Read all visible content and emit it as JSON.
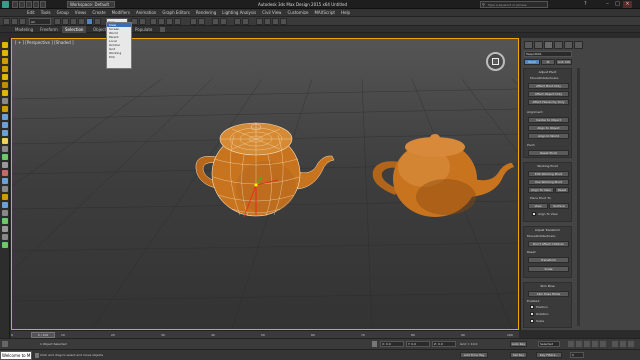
{
  "title_bar": {
    "workspace_label": "Workspace: Default",
    "app_title": "Autodesk 3ds Max Design 2015 x64    Untitled",
    "search_placeholder": "Type a keyword or phrase"
  },
  "menu": [
    "Edit",
    "Tools",
    "Group",
    "Views",
    "Create",
    "Modifiers",
    "Animation",
    "Graph Editors",
    "Rendering",
    "Lighting Analysis",
    "Civil View",
    "Customize",
    "MAXScript",
    "Help"
  ],
  "toolbar": {
    "selection_filter": "All",
    "reference_coord": "View"
  },
  "ribbon_tabs": [
    "Modeling",
    "Freeform",
    "Selection",
    "Object Paint",
    "Populate"
  ],
  "coord_dropdown": {
    "options": [
      "View",
      "Screen",
      "World",
      "Parent",
      "Local",
      "Gimbal",
      "Grid",
      "Working",
      "Pick"
    ],
    "selected": "View"
  },
  "viewport": {
    "label": "[ + ] [Perspective ] [Shaded ]"
  },
  "command_panel": {
    "object_name": "Teapot001",
    "tabs": [
      "Pivot",
      "IK",
      "Link Info"
    ],
    "adjust_pivot": {
      "title": "Adjust Pivot",
      "subtitle": "Move/Rotate/Scale:",
      "buttons": [
        "Affect Pivot Only",
        "Affect Object Only",
        "Affect Hierarchy Only"
      ]
    },
    "alignment": {
      "title": "Alignment:",
      "buttons": [
        "Center to Object",
        "Align to Object",
        "Align to World"
      ]
    },
    "pivot": {
      "title": "Pivot:",
      "buttons": [
        "Reset Pivot"
      ]
    },
    "working_pivot": {
      "title": "Working Pivot",
      "buttons": [
        "Edit Working Pivot",
        "Use Working Pivot",
        "Align To View",
        "Reset"
      ],
      "place_label": "Place Pivot To:",
      "place_buttons": [
        "View",
        "Surface"
      ],
      "align_label": "Align To View"
    },
    "adjust_transform": {
      "title": "Adjust Transform",
      "subtitle": "Move/Rotate/Scale:",
      "buttons": [
        "Don't Affect Children"
      ],
      "reset_label": "Reset:",
      "reset_buttons": [
        "Transform",
        "Scale"
      ]
    },
    "skin_pose": {
      "title": "Skin Pose",
      "button": "Skin Pose Mode",
      "enabled_label": "Enabled:",
      "checks": [
        "Position",
        "Rotation",
        "Scale"
      ]
    }
  },
  "timeline": {
    "frame_label": "0 / 100",
    "ticks": [
      "0",
      "5",
      "10",
      "15",
      "20",
      "25",
      "30",
      "35",
      "40",
      "45",
      "50",
      "55",
      "60",
      "65",
      "70",
      "75",
      "80",
      "85",
      "90",
      "95",
      "100"
    ]
  },
  "status": {
    "selection": "1 Object Selected",
    "prompt": "Click and drag to select and move objects",
    "welcome": "Welcome to M",
    "x_value": "X: 0.0",
    "y_value": "Y: 0.0",
    "z_value": "Z: 0.0",
    "grid": "Grid = 10.0",
    "add_time_tag": "Add Time Tag",
    "auto_key": "Auto Key",
    "set_key": "Set Key",
    "key_mode": "Selected",
    "key_filters": "Key Filters...",
    "frame_field": "0"
  },
  "colors": {
    "teapot": "#c8741f",
    "teapot_shade": "#8a4a10",
    "wire": "#f5e2c0",
    "viewport_border": "#f2a400",
    "accent_blue": "#4d86c0"
  }
}
